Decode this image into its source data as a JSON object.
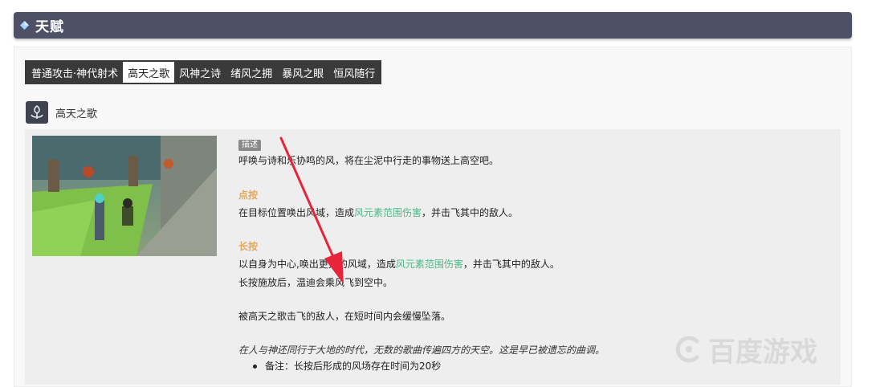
{
  "header": {
    "title": "天赋",
    "icon": "diamond-icon",
    "bg_color": "#4e5066"
  },
  "tabs": [
    {
      "label": "普通攻击·神代射术",
      "active": false
    },
    {
      "label": "高天之歌",
      "active": true
    },
    {
      "label": "风神之诗",
      "active": false
    },
    {
      "label": "绪风之拥",
      "active": false
    },
    {
      "label": "暴风之眼",
      "active": false
    },
    {
      "label": "恒风随行",
      "active": false
    }
  ],
  "skill": {
    "name": "高天之歌",
    "icon": "wind-skill-icon",
    "tag": "描述",
    "intro": "呼唤与诗和乐协鸣的风，将在尘泥中行走的事物送上高空吧。",
    "tap": {
      "heading": "点按",
      "pre": "在目标位置唤出风域，造成",
      "highlight": "风元素范围伤害",
      "post": "，并击飞其中的敌人。"
    },
    "hold": {
      "heading": "长按",
      "pre": "以自身为中心,唤出更大的风域，造成",
      "highlight": "风元素范围伤害",
      "post": "，并击飞其中的敌人。",
      "line2": "长按施放后，温迪会乘风飞到空中。"
    },
    "effect": "被高天之歌击飞的敌人，在短时间内会缓慢坠落。",
    "flavor": "在人与神还同行于大地的时代，无数的歌曲传遍四方的天空。这是早已被遗忘的曲调。",
    "note": "备注：长按后形成的风场存在时间为20秒"
  },
  "colors": {
    "accent_heading": "#e3a85a",
    "element_text": "#4db88a",
    "arrow": "#e8243a"
  },
  "watermark": {
    "text": "百度游戏"
  }
}
